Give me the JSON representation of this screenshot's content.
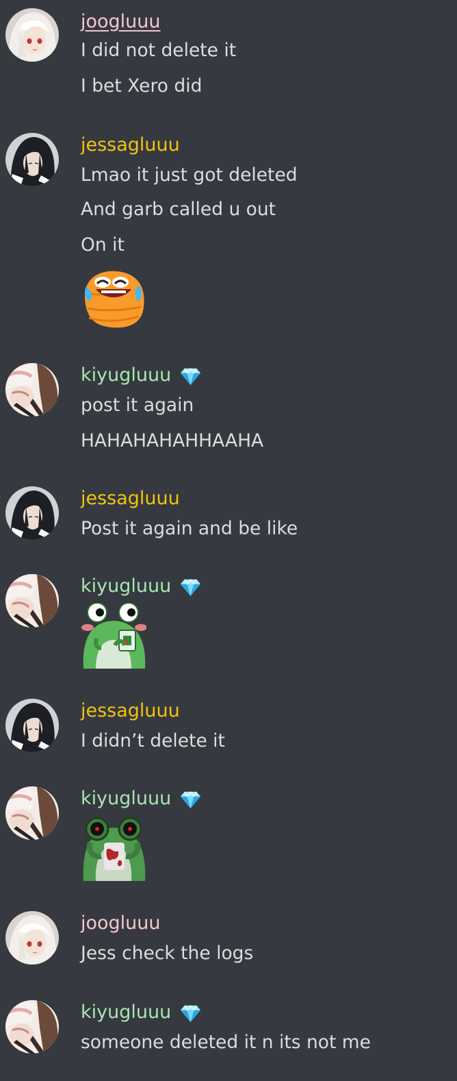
{
  "colors": {
    "background": "#36393f",
    "message_text": "#dcddde",
    "joogluuu": "#f4c7cf",
    "jessagluuu": "#f1c40f",
    "kiyugluuu": "#a8e6b0"
  },
  "messages": [
    {
      "author": "joogluuu",
      "avatar": "white-haired-avatar",
      "lines": [
        "I did not delete it",
        "I bet Xero did"
      ]
    },
    {
      "author": "jessagluuu",
      "avatar": "black-haired-avatar",
      "lines": [
        "Lmao it just got deleted",
        "And garb called u out",
        "On it"
      ],
      "emoji": "crying-laughing-blob-emoji"
    },
    {
      "author": "kiyugluuu",
      "avatar": "brown-haired-avatar",
      "badge": "diamond-icon",
      "lines": [
        "post it again",
        "HAHAHAHAHHAAHA"
      ]
    },
    {
      "author": "jessagluuu",
      "avatar": "black-haired-avatar",
      "lines": [
        "Post it again and be like"
      ]
    },
    {
      "author": "kiyugluuu",
      "avatar": "brown-haired-avatar",
      "badge": "diamond-icon",
      "emoji": "frog-drinking-emoji"
    },
    {
      "author": "jessagluuu",
      "avatar": "black-haired-avatar",
      "lines": [
        "I didn’t delete it"
      ]
    },
    {
      "author": "kiyugluuu",
      "avatar": "brown-haired-avatar",
      "badge": "diamond-icon",
      "emoji": "bloody-frog-emoji"
    },
    {
      "author": "joogluuu",
      "avatar": "white-haired-avatar",
      "lines": [
        "Jess check the logs"
      ]
    },
    {
      "author": "kiyugluuu",
      "avatar": "brown-haired-avatar",
      "badge": "diamond-icon",
      "lines": [
        "someone deleted it n its not me"
      ]
    }
  ]
}
